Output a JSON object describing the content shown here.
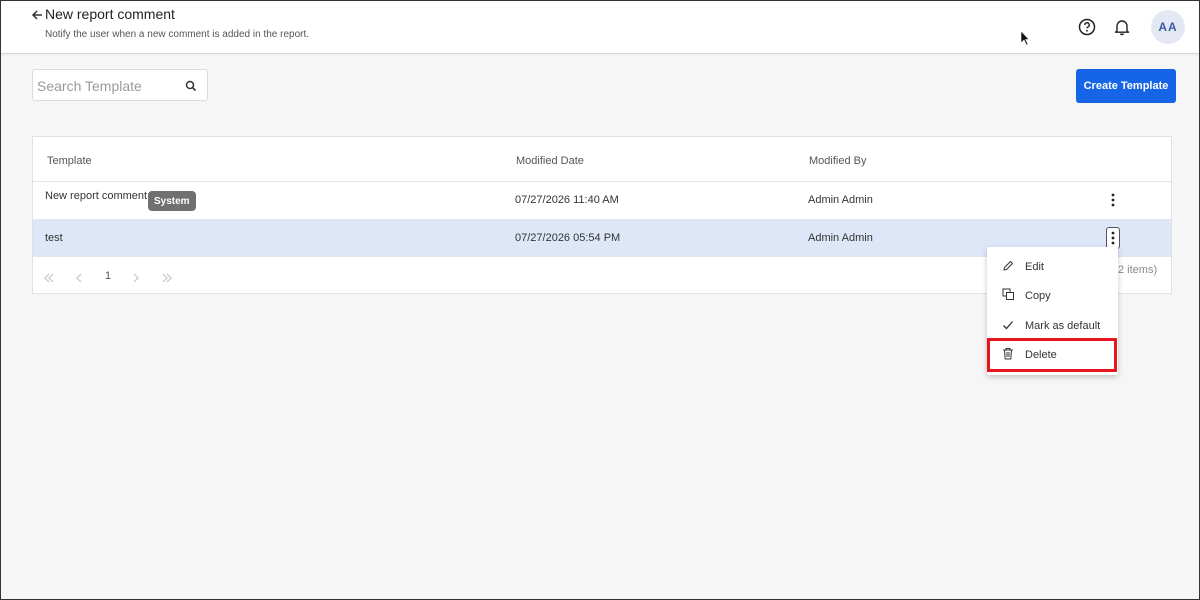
{
  "header": {
    "title": "New report comment",
    "subtitle": "Notify the user when a new comment is added in the report.",
    "avatar_initials": "AA"
  },
  "toolbar": {
    "search_placeholder": "Search Template",
    "create_label": "Create Template"
  },
  "table": {
    "columns": [
      "Template",
      "Modified Date",
      "Modified By"
    ],
    "rows": [
      {
        "template": "New report comment",
        "badge": "System",
        "modified_date": "07/27/2026 11:40 AM",
        "modified_by": "Admin Admin"
      },
      {
        "template": "test",
        "badge": "",
        "modified_date": "07/27/2026 05:54 PM",
        "modified_by": "Admin Admin"
      }
    ]
  },
  "pager": {
    "current_page": "1",
    "items_label": "2 items)"
  },
  "context_menu": {
    "items": [
      {
        "label": "Edit",
        "icon": "pencil-icon"
      },
      {
        "label": "Copy",
        "icon": "copy-icon"
      },
      {
        "label": "Mark as default",
        "icon": "check-icon"
      },
      {
        "label": "Delete",
        "icon": "trash-icon"
      }
    ]
  },
  "colors": {
    "primary": "#1565e6",
    "selected_row": "#dde7f7",
    "highlight": "#e8141b"
  }
}
